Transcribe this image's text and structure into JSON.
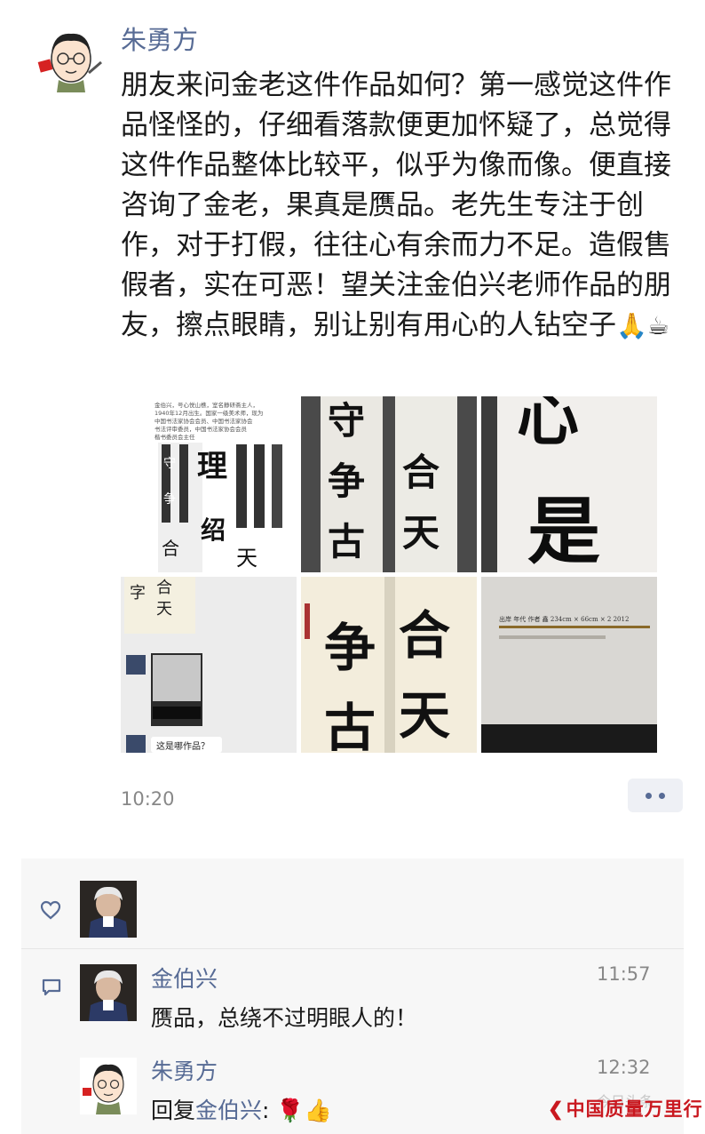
{
  "post": {
    "author": "朱勇方",
    "text": "朋友来问金老这件作品如何？第一感觉这件作品怪怪的，仔细看落款便更加怀疑了，总觉得这件作品整体比较平，似乎为像而像。便直接咨询了金老，果真是赝品。老先生专注于创作，对于打假，往往心有余而力不足。造假售假者，实在可恶！望关注金伯兴老师作品的朋友，擦点眼睛，别让别有用心的人钻空子",
    "text_emoji": "🙏☕",
    "time": "10:20",
    "photos": {
      "p1_text_lines": [
        "金伯兴，号心悦山樵，室名静研斋主人，",
        "1940年12月出生。国家一级美术师，现为",
        "中国书法家协会会员、中国书法家协会",
        "书法评审委员，中国书法家协会会员",
        "楷书委员会主任"
      ],
      "p2_chars": [
        "守",
        "争",
        "古"
      ],
      "p2b_chars": [
        "合",
        "天"
      ],
      "p3_chars": [
        "心",
        "是"
      ],
      "p4_chars": [
        "字",
        "合",
        "天"
      ],
      "p4_chat_text": "这是哪作品？",
      "p5_chars": [
        "争",
        "古"
      ],
      "p6_chars": [
        "合",
        "天"
      ],
      "p7_caption": "出岸  年代  作者  鑫  234cm × 66cm × 2  2012"
    }
  },
  "likes": {},
  "comments": [
    {
      "name": "金伯兴",
      "time": "11:57",
      "text": "赝品，总绕不过明眼人的！"
    },
    {
      "name": "朱勇方",
      "time": "12:32",
      "prefix": "回复",
      "target": "金伯兴",
      "suffix": ":",
      "emoji": "🌹👍"
    }
  ],
  "watermark": {
    "faint": "今日头条",
    "brand": "中国质量万里行"
  },
  "colors": {
    "link": "#576b95",
    "comment_bg": "#f7f7f7",
    "brand_red": "#c9181f"
  }
}
